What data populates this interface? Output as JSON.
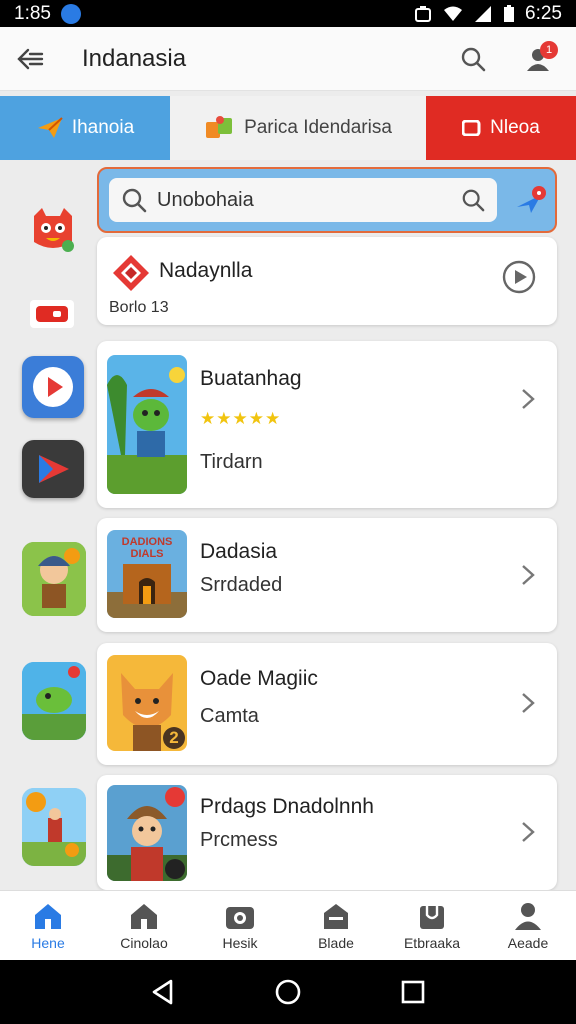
{
  "status": {
    "time_left": "1:85",
    "time_right": "6:25"
  },
  "appbar": {
    "title": "Indanasia",
    "notif_count": "1"
  },
  "tabs": [
    {
      "label": "Ihanoia"
    },
    {
      "label": "Parica Idendarisa"
    },
    {
      "label": "Nleoa"
    }
  ],
  "search": {
    "value": "Unobohaia"
  },
  "featured": {
    "title": "Nadaynlla",
    "subtitle": "Borlo  13"
  },
  "cards": [
    {
      "title": "Buatanhag",
      "rating": "★★★★★",
      "subtitle": "Tirdarn"
    },
    {
      "title": "Dadasia",
      "subtitle": "Srrdaded",
      "thumb_text": "DADIONS DIALS"
    },
    {
      "title": "Oade Magiic",
      "subtitle": "Camta",
      "badge": "2"
    },
    {
      "title": "Prdags Dnadolnnh",
      "subtitle": "Prcmess"
    }
  ],
  "bottomnav": [
    {
      "label": "Hene"
    },
    {
      "label": "Cinolao"
    },
    {
      "label": "Hesik"
    },
    {
      "label": "Blade"
    },
    {
      "label": "Etbraaka"
    },
    {
      "label": "Aeade"
    }
  ],
  "colors": {
    "accent": "#2a7be4",
    "tab1": "#4ea2e0",
    "tab3": "#e02b23",
    "search_border": "#e36a3a"
  }
}
